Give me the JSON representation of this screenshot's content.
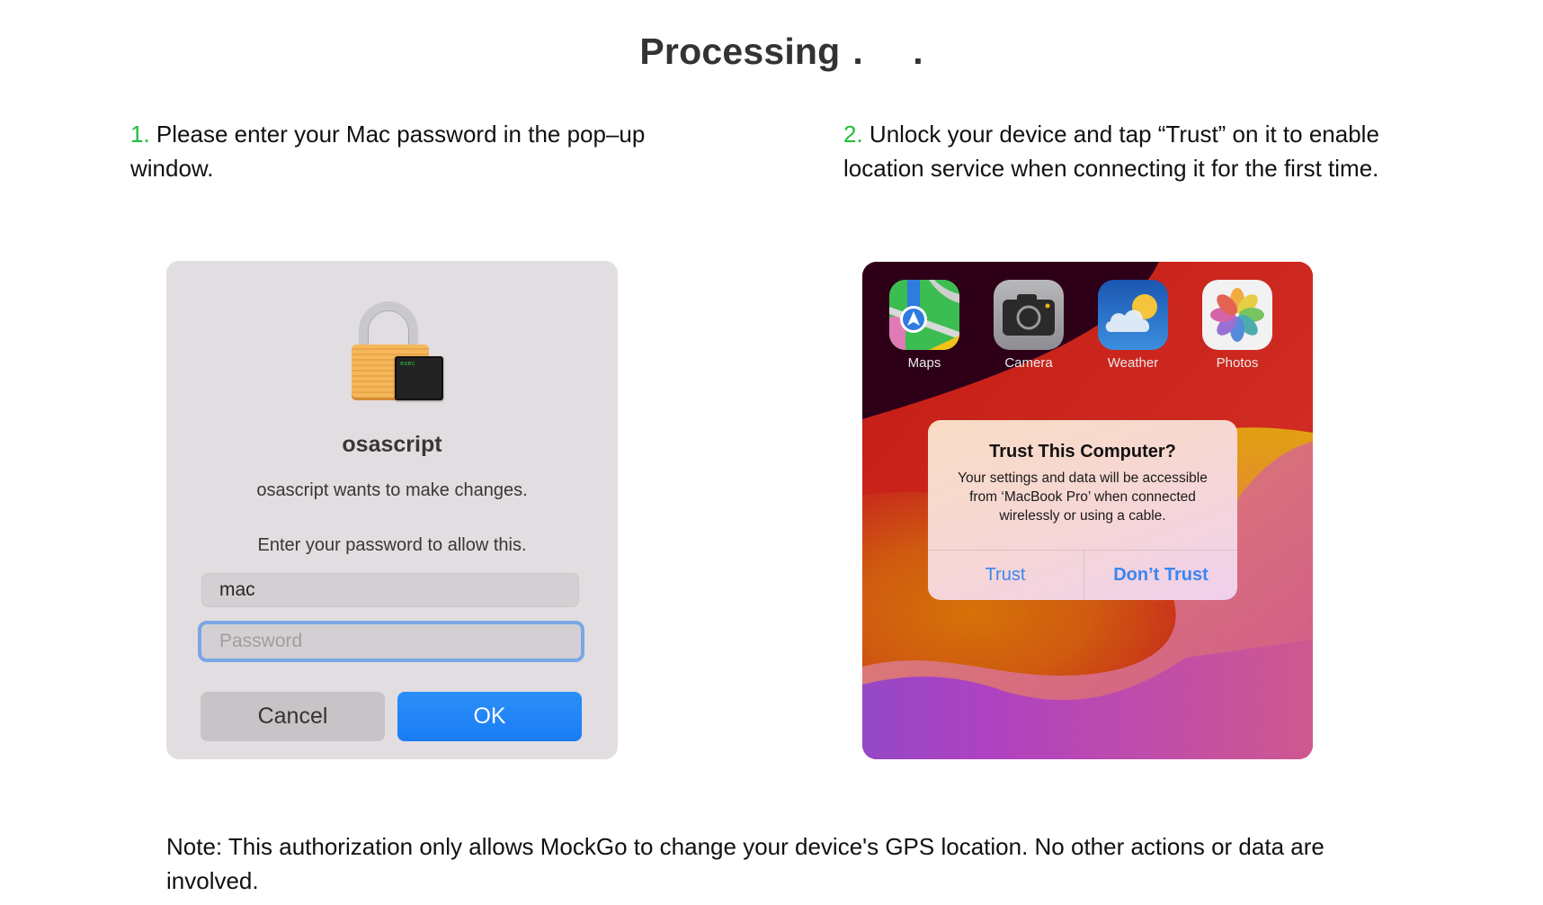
{
  "title": {
    "text": "Processing",
    "dots": ". ."
  },
  "steps": [
    {
      "number": "1.",
      "text": " Please enter your Mac password in the pop–up window."
    },
    {
      "number": "2.",
      "text": " Unlock your device and tap “Trust” on it to enable location service when connecting it for the first time."
    }
  ],
  "mac_dialog": {
    "icon": "lock-terminal-icon",
    "terminal_label": "exec",
    "app_name": "osascript",
    "message": "osascript wants to make changes.",
    "prompt": "Enter your password to allow this.",
    "username_value": "mac",
    "password_placeholder": "Password",
    "cancel_label": "Cancel",
    "ok_label": "OK",
    "colors": {
      "ok_button": "#1a7cf5",
      "focus_ring": "#7aa6e6"
    }
  },
  "phone_screen": {
    "apps": [
      {
        "label": "Maps",
        "icon": "maps-icon"
      },
      {
        "label": "Camera",
        "icon": "camera-icon"
      },
      {
        "label": "Weather",
        "icon": "weather-icon"
      },
      {
        "label": "Photos",
        "icon": "photos-icon"
      }
    ],
    "alert": {
      "title": "Trust This Computer?",
      "message": "Your settings and data will be accessible from ‘MacBook Pro’ when connected wirelessly or using a cable.",
      "trust_label": "Trust",
      "dont_trust_label": "Don’t Trust",
      "button_color": "#3a86f0"
    }
  },
  "note": "Note: This authorization only allows MockGo to change your device's GPS location. No other actions or data are involved.",
  "colors": {
    "step_number": "#1fbf3a",
    "title": "#333333"
  }
}
